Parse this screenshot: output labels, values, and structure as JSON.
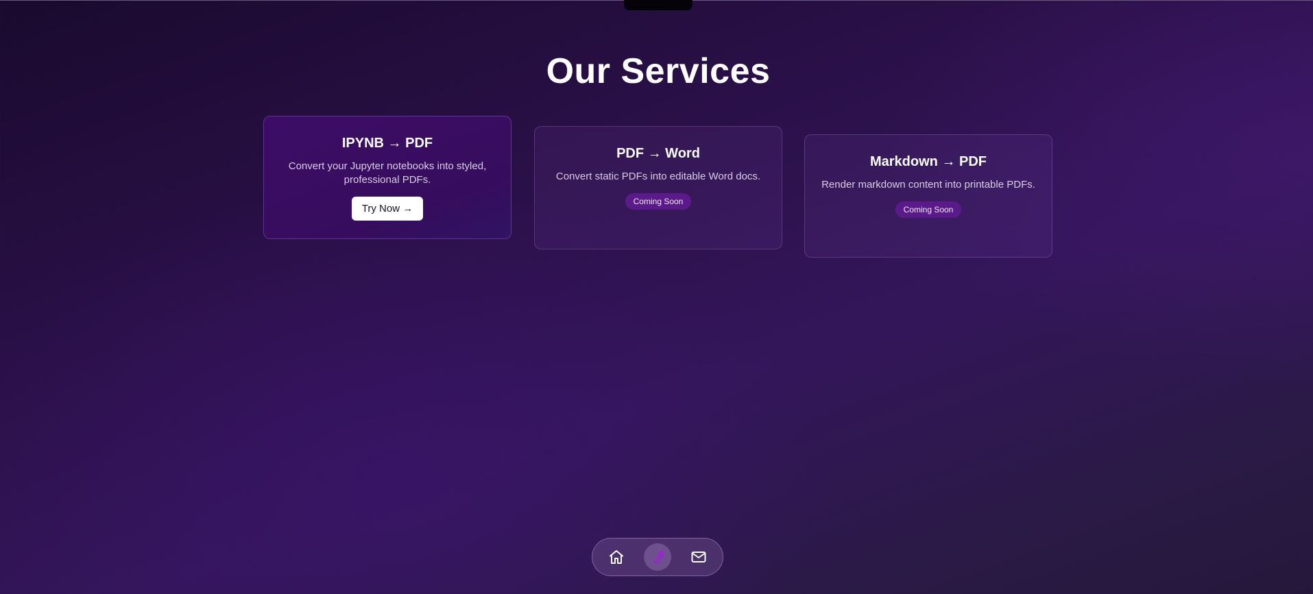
{
  "page": {
    "title": "Our Services"
  },
  "services": [
    {
      "title": "IPYNB → PDF",
      "description": "Convert your Jupyter notebooks into styled, professional PDFs.",
      "action_label": "Try Now →"
    },
    {
      "title": "PDF → Word",
      "description": "Convert static PDFs into editable Word docs.",
      "badge": "Coming Soon"
    },
    {
      "title": "Markdown → PDF",
      "description": "Render markdown content into printable PDFs.",
      "badge": "Coming Soon"
    }
  ],
  "dock": {
    "items": [
      {
        "icon": "home-icon",
        "active": false
      },
      {
        "icon": "wrench-icon",
        "active": true
      },
      {
        "icon": "mail-icon",
        "active": false
      }
    ]
  },
  "colors": {
    "accent": "#5a1a8a",
    "active_icon": "#a020d8",
    "featured_card": "#3d0d66"
  }
}
